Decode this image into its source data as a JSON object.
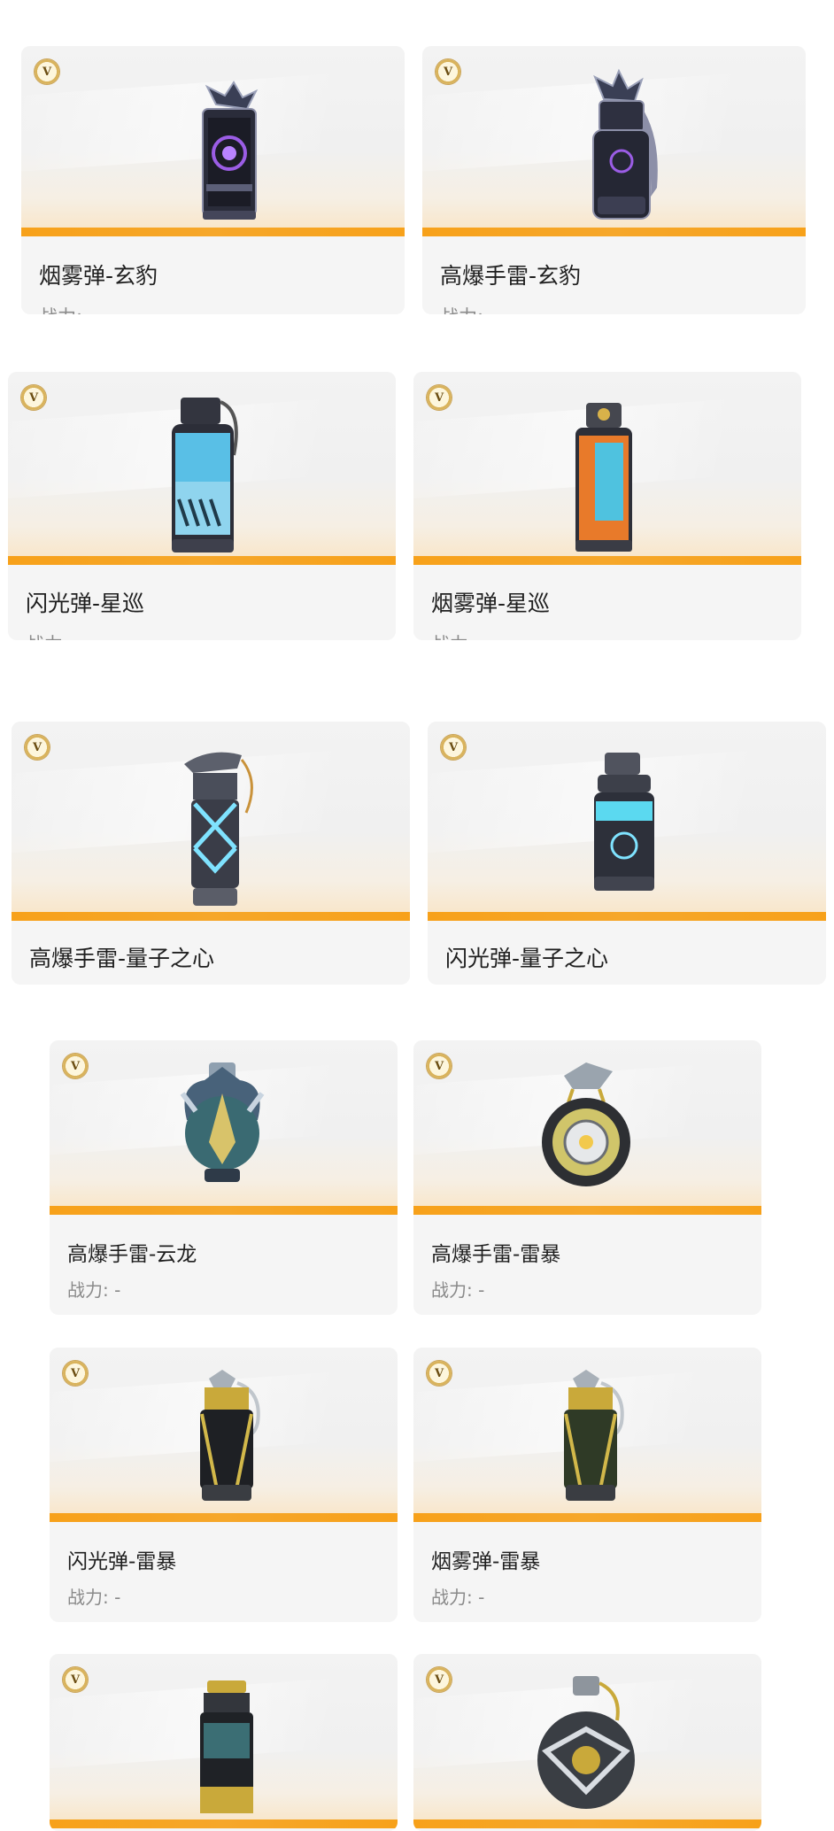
{
  "badge_letter": "V",
  "power_label": "战力: -",
  "accent": "#f7a11a",
  "items": [
    {
      "name": "烟雾弹-玄豹",
      "icon": "smoke-grenade-panther-icon"
    },
    {
      "name": "高爆手雷-玄豹",
      "icon": "frag-grenade-panther-icon"
    },
    {
      "name": "闪光弹-星巡",
      "icon": "flash-grenade-starpatrol-icon"
    },
    {
      "name": "烟雾弹-星巡",
      "icon": "smoke-grenade-starpatrol-icon"
    },
    {
      "name": "高爆手雷-量子之心",
      "icon": "frag-grenade-quantum-icon"
    },
    {
      "name": "闪光弹-量子之心",
      "icon": "flash-grenade-quantum-icon"
    },
    {
      "name": "高爆手雷-云龙",
      "icon": "frag-grenade-cloud-dragon-icon"
    },
    {
      "name": "高爆手雷-雷暴",
      "icon": "frag-grenade-thunderstorm-icon"
    },
    {
      "name": "闪光弹-雷暴",
      "icon": "flash-grenade-thunderstorm-icon"
    },
    {
      "name": "烟雾弹-雷暴",
      "icon": "smoke-grenade-thunderstorm-icon"
    },
    {
      "name": "",
      "icon": "grenade-canister-icon"
    },
    {
      "name": "",
      "icon": "frag-grenade-round-icon"
    }
  ]
}
